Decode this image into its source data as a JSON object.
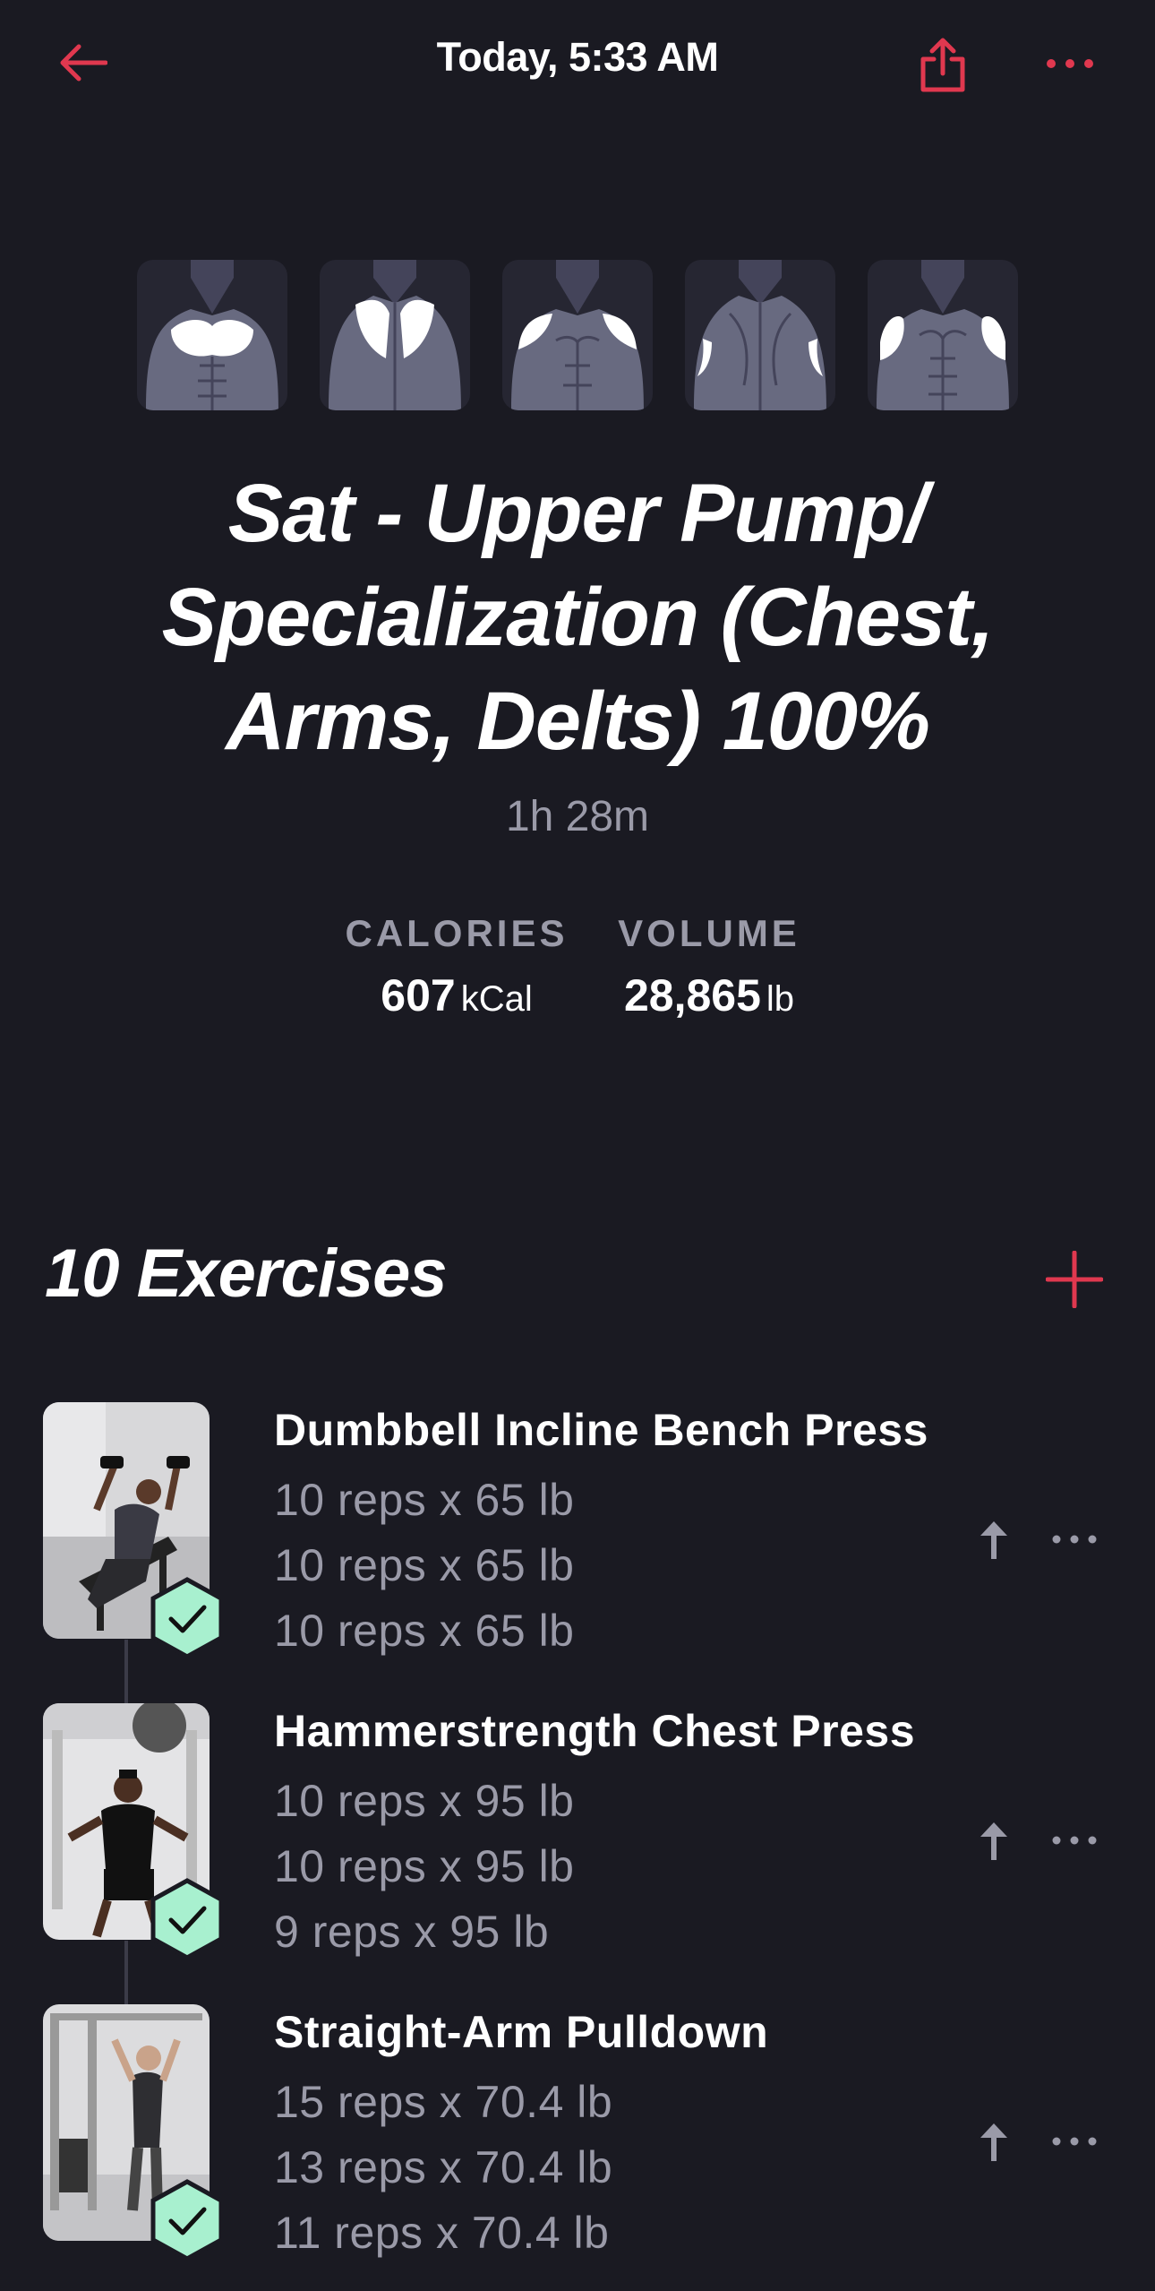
{
  "header": {
    "title": "Today, 5:33 AM",
    "back_icon": "arrow-left-icon",
    "share_icon": "share-icon",
    "more_icon": "more-horizontal-icon"
  },
  "muscle_groups": [
    "chest",
    "upper-back",
    "front-delts",
    "rear-arms",
    "arms"
  ],
  "workout": {
    "title": "Sat - Upper Pump/ Specialization (Chest, Arms, Delts) 100%",
    "duration": "1h 28m"
  },
  "stats": {
    "calories": {
      "label": "CALORIES",
      "value": "607",
      "unit": "kCal"
    },
    "volume": {
      "label": "VOLUME",
      "value": "28,865",
      "unit": "lb"
    }
  },
  "exercises_section": {
    "heading": "10 Exercises",
    "add_icon": "plus-icon"
  },
  "exercises": [
    {
      "name": "Dumbbell Incline Bench Press",
      "sets": [
        "10 reps x 65 lb",
        "10 reps x 65 lb",
        "10 reps x 65 lb"
      ]
    },
    {
      "name": "Hammerstrength Chest Press",
      "sets": [
        "10 reps x 95 lb",
        "10 reps x 95 lb",
        "9 reps x 95 lb"
      ]
    },
    {
      "name": "Straight-Arm Pulldown",
      "sets": [
        "15 reps x 70.4 lb",
        "13 reps x 70.4 lb",
        "11 reps x 70.4 lb"
      ]
    }
  ],
  "colors": {
    "accent": "#e0384f",
    "background": "#1a1a22",
    "muted_text": "#9a9aa8",
    "check_fill": "#a8f0cf"
  }
}
